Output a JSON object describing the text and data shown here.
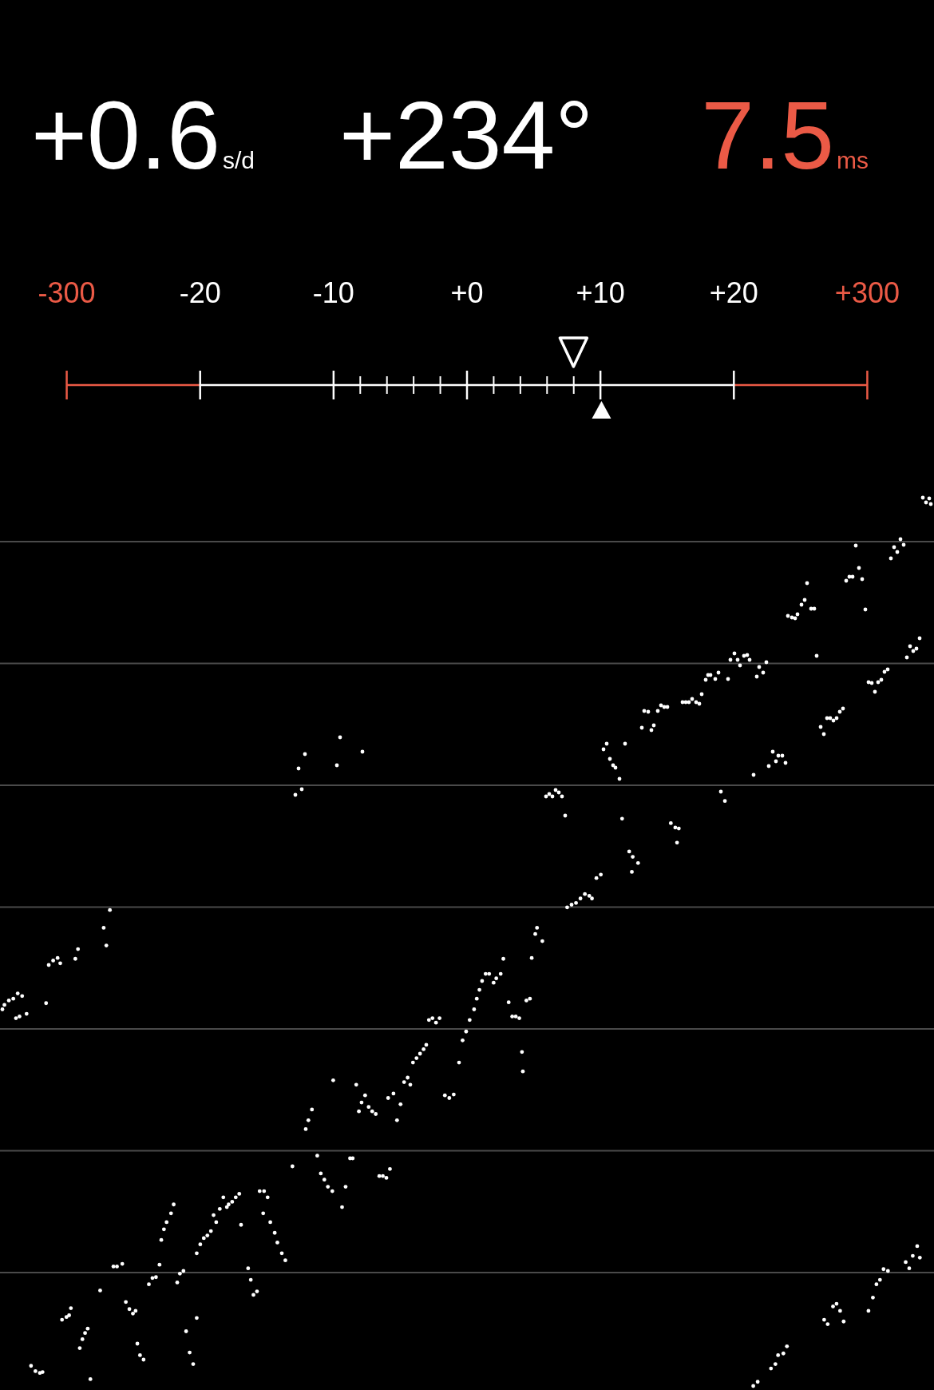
{
  "readings": [
    {
      "value": "+0.6",
      "unit": "s/d",
      "warning": false
    },
    {
      "value": "+234°",
      "warning": false
    },
    {
      "value": "7.5",
      "unit": "ms",
      "warning": true
    }
  ],
  "scale": {
    "labels": [
      {
        "text": "-300",
        "out_of_range": true
      },
      {
        "text": "-20",
        "out_of_range": false
      },
      {
        "text": "-10",
        "out_of_range": false
      },
      {
        "text": "+0",
        "out_of_range": false
      },
      {
        "text": "+10",
        "out_of_range": false
      },
      {
        "text": "+20",
        "out_of_range": false
      },
      {
        "text": "+300",
        "out_of_range": true
      }
    ],
    "markers": [
      {
        "kind": "hollow",
        "level": 0.633
      },
      {
        "kind": "filled",
        "level": 0.668
      }
    ]
  }
}
